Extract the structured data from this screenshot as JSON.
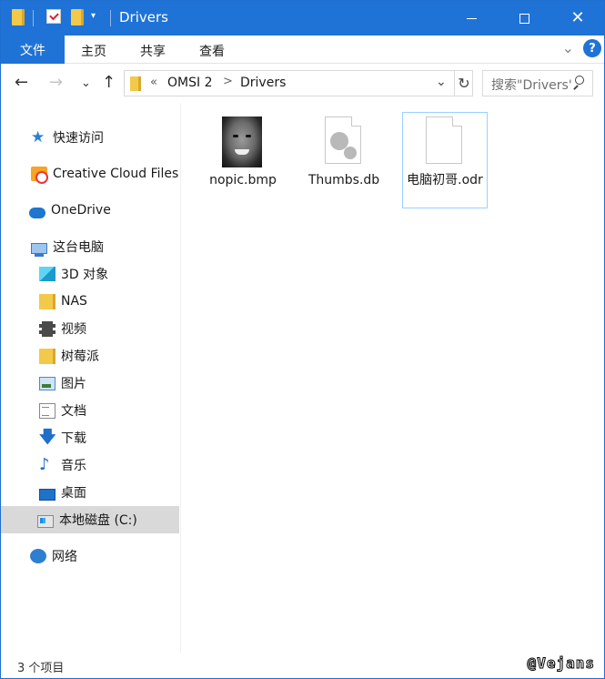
{
  "window": {
    "title": "Drivers",
    "accent_color": "#1f73d6"
  },
  "ribbon": {
    "tabs": [
      {
        "label": "文件",
        "active": true
      },
      {
        "label": "主页"
      },
      {
        "label": "共享"
      },
      {
        "label": "查看"
      }
    ],
    "help_label": "?"
  },
  "address": {
    "overflow": "«",
    "segments": [
      "OMSI 2",
      "Drivers"
    ],
    "separator": ">"
  },
  "search": {
    "placeholder": "搜索\"Drivers\""
  },
  "sidebar": {
    "items": [
      {
        "label": "快速访问",
        "icon": "quick-access-star-icon"
      },
      {
        "label": "Creative Cloud Files",
        "icon": "creative-cloud-icon"
      },
      {
        "label": "OneDrive",
        "icon": "onedrive-cloud-icon"
      },
      {
        "label": "这台电脑",
        "icon": "this-pc-icon"
      },
      {
        "label": "3D 对象",
        "icon": "3d-objects-icon"
      },
      {
        "label": "NAS",
        "icon": "folder-icon"
      },
      {
        "label": "视频",
        "icon": "video-icon"
      },
      {
        "label": "树莓派",
        "icon": "folder-icon"
      },
      {
        "label": "图片",
        "icon": "pictures-icon"
      },
      {
        "label": "文档",
        "icon": "documents-icon"
      },
      {
        "label": "下载",
        "icon": "download-icon"
      },
      {
        "label": "音乐",
        "icon": "music-icon"
      },
      {
        "label": "桌面",
        "icon": "desktop-icon"
      },
      {
        "label": "本地磁盘 (C:)",
        "icon": "local-disk-icon",
        "selected": true
      },
      {
        "label": "网络",
        "icon": "network-icon"
      }
    ]
  },
  "files": [
    {
      "name": "nopic.bmp",
      "icon": "bitmap-thumbnail-icon"
    },
    {
      "name": "Thumbs.db",
      "icon": "system-file-gear-icon"
    },
    {
      "name": "电脑初哥.odr",
      "icon": "blank-file-icon",
      "selected": true
    }
  ],
  "status": {
    "item_count": "3 个项目"
  },
  "watermark": "@Vejans"
}
